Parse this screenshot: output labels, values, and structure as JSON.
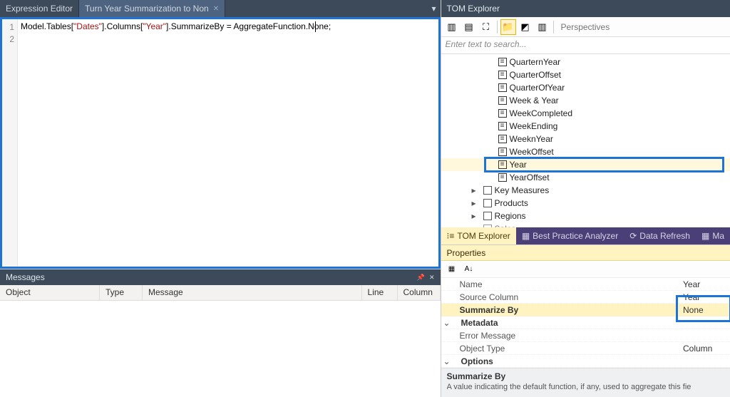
{
  "editor": {
    "tabs": [
      {
        "label": "Expression Editor",
        "active": false
      },
      {
        "label": "Turn Year Summarization to Non",
        "active": true
      }
    ],
    "gutter": [
      "1",
      "2"
    ],
    "code": {
      "prefix": "Model.Tables[",
      "str1": "\"Dates\"",
      "mid1": "].Columns[",
      "str2": "\"Year\"",
      "suffix": "].SummarizeBy = AggregateFunction.None;"
    }
  },
  "messages": {
    "title": "Messages",
    "columns": {
      "object": "Object",
      "type": "Type",
      "message": "Message",
      "line": "Line",
      "column": "Column"
    }
  },
  "tom": {
    "title": "TOM Explorer",
    "search_placeholder": "Enter text to search...",
    "perspectives_placeholder": "Perspectives",
    "columns": [
      "QuarternYear",
      "QuarterOffset",
      "QuarterOfYear",
      "Week & Year",
      "WeekCompleted",
      "WeekEnding",
      "WeeknYear",
      "WeekOffset",
      "Year",
      "YearOffset"
    ],
    "tables": [
      "Key Measures",
      "Products",
      "Regions",
      "Sales"
    ],
    "tabs": [
      "TOM Explorer",
      "Best Practice Analyzer",
      "Data Refresh",
      "Ma"
    ]
  },
  "properties": {
    "title": "Properties",
    "rows": {
      "name": {
        "label": "Name",
        "value": "Year"
      },
      "source_column": {
        "label": "Source Column",
        "value": "Year"
      },
      "summarize_by": {
        "label": "Summarize By",
        "value": "None"
      },
      "metadata_cat": "Metadata",
      "error_message": {
        "label": "Error Message",
        "value": ""
      },
      "object_type": {
        "label": "Object Type",
        "value": "Column"
      },
      "options_cat": "Options"
    },
    "desc": {
      "title": "Summarize By",
      "text": "A value indicating the default function, if any, used to aggregate this fie"
    }
  }
}
